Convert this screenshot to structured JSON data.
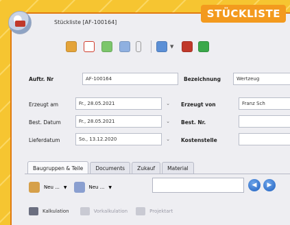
{
  "badge": {
    "text": "STÜCKLISTE"
  },
  "window": {
    "title": "Stückliste [AF-100164]"
  },
  "form": {
    "auftr_label": "Auftr. Nr",
    "auftr_value": "AF-100164",
    "bezeichnung_label": "Bezeichnung",
    "bezeichnung_value": "Wertzeug",
    "erzeugt_am_label": "Erzeugt am",
    "erzeugt_am_value": "Fr., 28.05.2021",
    "erzeugt_von_label": "Erzeugt von",
    "erzeugt_von_value": "Franz Sch",
    "best_datum_label": "Best. Datum",
    "best_datum_value": "Fr., 28.05.2021",
    "best_nr_label": "Best. Nr.",
    "best_nr_value": "",
    "lieferdatum_label": "Lieferdatum",
    "lieferdatum_value": "So., 13.12.2020",
    "kostenstelle_label": "Kostenstelle",
    "kostenstelle_value": ""
  },
  "tabs": [
    {
      "label": "Baugruppen & Teile"
    },
    {
      "label": "Documents"
    },
    {
      "label": "Zukauf"
    },
    {
      "label": "Material"
    }
  ],
  "subtoolbar": {
    "new1_label": "Neu ...",
    "new2_label": "Neu ..."
  },
  "actions": {
    "kalkulation_label": "Kalkulation",
    "vorkalkulation_label": "Vorkalkulation",
    "projektart_label": "Projektart"
  },
  "colors": {
    "background": "#f6c531",
    "badge": "#f39a1e",
    "window_border": "#e07a12",
    "nav_blue": "#1d5fbf"
  }
}
